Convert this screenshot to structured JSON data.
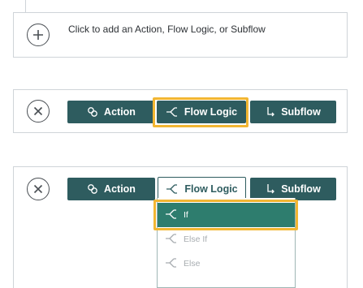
{
  "add_panel": {
    "prompt": "Click to add an Action, Flow Logic, or Subflow",
    "icon": "plus-circle-icon"
  },
  "chooser": {
    "close_icon": "close-circle-icon",
    "buttons": [
      {
        "label": "Action",
        "icon": "action-icon"
      },
      {
        "label": "Flow Logic",
        "icon": "flow-logic-icon"
      },
      {
        "label": "Subflow",
        "icon": "subflow-icon"
      }
    ]
  },
  "dropdown": {
    "items": [
      {
        "label": "If",
        "state": "selected"
      },
      {
        "label": "Else If",
        "state": "disabled"
      },
      {
        "label": "Else",
        "state": "disabled"
      }
    ]
  },
  "colors": {
    "button_bg": "#2e5c5f",
    "highlight": "#f2b632",
    "menu_active": "#2e7d6e"
  }
}
